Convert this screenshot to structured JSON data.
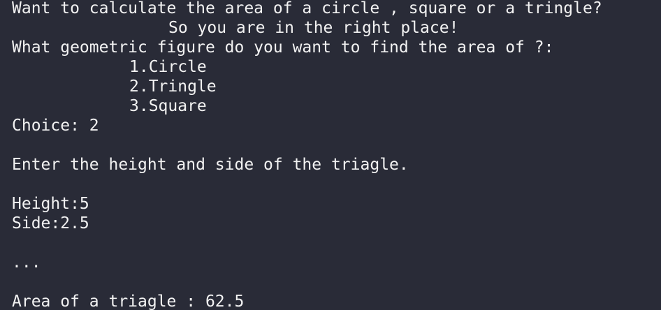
{
  "terminal": {
    "intro_line": "Want to calculate the area of a circle , square or a tringle?",
    "welcome_line": "So you are in the right place!",
    "question_line": "What geometric figure do you want to find the area of ?:",
    "menu": [
      "1.Circle",
      "2.Tringle",
      "3.Square"
    ],
    "choice_line": "Choice: 2",
    "prompt_line": "Enter the height and side of the triagle.",
    "height_line": "Height:5",
    "side_line": "Side:2.5",
    "ellipsis_line": "...",
    "result_line": "Area of a triagle : 62.5"
  }
}
